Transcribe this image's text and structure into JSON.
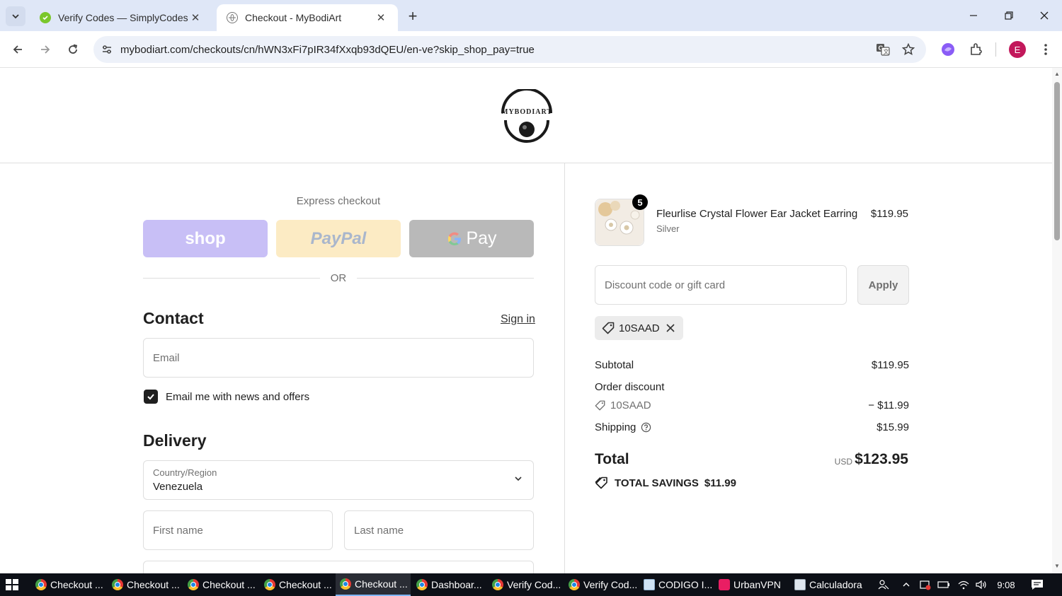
{
  "browser": {
    "tabs": [
      {
        "title": "Verify Codes — SimplyCodes",
        "active": false
      },
      {
        "title": "Checkout - MyBodiArt",
        "active": true
      }
    ],
    "url": "mybodiart.com/checkouts/cn/hWN3xFi7pIR34fXxqb93dQEU/en-ve?skip_shop_pay=true",
    "profile_initial": "E"
  },
  "header": {
    "logo_text": "MYBODIART"
  },
  "checkout": {
    "express_label": "Express checkout",
    "shop_label": "shop",
    "paypal_label": "PayPal",
    "gpay_label": "Pay",
    "or_label": "OR",
    "contact_title": "Contact",
    "signin_label": "Sign in",
    "email_placeholder": "Email",
    "newsletter_label": "Email me with news and offers",
    "newsletter_checked": true,
    "delivery_title": "Delivery",
    "country_label": "Country/Region",
    "country_value": "Venezuela",
    "first_name_placeholder": "First name",
    "last_name_placeholder": "Last name"
  },
  "summary": {
    "product": {
      "name": "Fleurlise Crystal Flower Ear Jacket Earring",
      "variant": "Silver",
      "price": "$119.95",
      "quantity": "5"
    },
    "discount_placeholder": "Discount code or gift card",
    "apply_label": "Apply",
    "applied_code": "10SAAD",
    "subtotal_label": "Subtotal",
    "subtotal_value": "$119.95",
    "order_discount_label": "Order discount",
    "discount_code": "10SAAD",
    "discount_value": "− $11.99",
    "shipping_label": "Shipping",
    "shipping_value": "$15.99",
    "total_label": "Total",
    "total_currency": "USD",
    "total_value": "$123.95",
    "savings_label": "TOTAL SAVINGS",
    "savings_value": "$11.99"
  },
  "taskbar": {
    "items": [
      {
        "label": "Checkout ...",
        "icon": "chrome-icon"
      },
      {
        "label": "Checkout ...",
        "icon": "chrome-icon"
      },
      {
        "label": "Checkout ...",
        "icon": "chrome-icon"
      },
      {
        "label": "Checkout ...",
        "icon": "chrome-icon"
      },
      {
        "label": "Checkout ...",
        "icon": "chrome-icon"
      },
      {
        "label": "Dashboar...",
        "icon": "chrome-icon"
      },
      {
        "label": "Verify Cod...",
        "icon": "chrome-icon"
      },
      {
        "label": "Verify Cod...",
        "icon": "chrome-icon"
      },
      {
        "label": "CODIGO I...",
        "icon": "notepad-icon"
      },
      {
        "label": "UrbanVPN",
        "icon": "urbanvpn-icon"
      },
      {
        "label": "Calculadora",
        "icon": "calculator-icon"
      }
    ],
    "clock": "9:08"
  }
}
